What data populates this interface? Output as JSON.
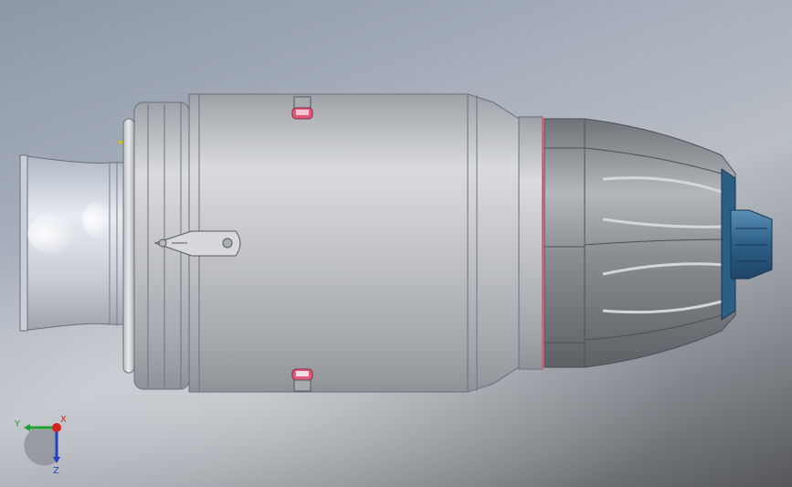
{
  "viewport": {
    "background_top": "#8d97a8",
    "background_bottom": "#55575b"
  },
  "model": {
    "body_color": "#c8cbd0",
    "nozzle_color": "#2d5f86",
    "highlight_color": "#e05a78"
  },
  "triad": {
    "x_label": "X",
    "y_label": "Y",
    "z_label": "Z",
    "x_color": "#d62020",
    "y_color": "#20a030",
    "z_color": "#2040c8"
  }
}
